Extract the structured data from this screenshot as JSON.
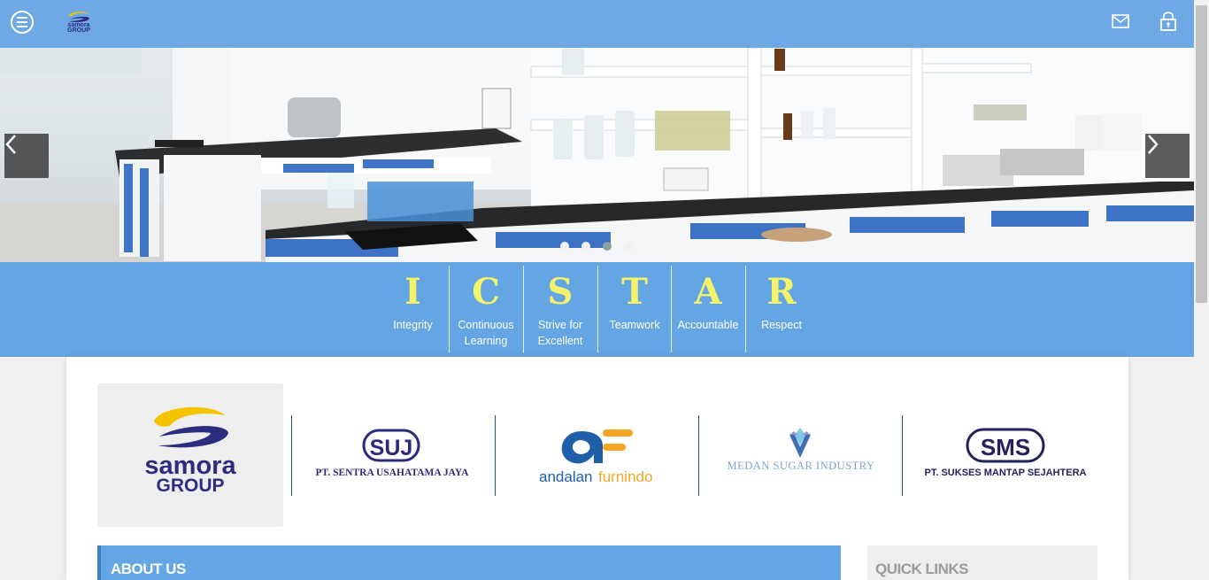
{
  "header": {
    "menu_label": "menu",
    "brand_logo_text_line1": "samora",
    "brand_logo_text_line2": "GROUP",
    "icons": [
      "menu-icon",
      "mail-icon",
      "lock-icon"
    ]
  },
  "hero": {
    "slide_count": 4,
    "active_slide": 3,
    "icons": [
      "chevron-left-icon",
      "chevron-right-icon"
    ]
  },
  "values": [
    {
      "letter": "I",
      "line1": "Integrity",
      "line2": ""
    },
    {
      "letter": "C",
      "line1": "Continuous",
      "line2": "Learning"
    },
    {
      "letter": "S",
      "line1": "Strive for",
      "line2": "Excellent"
    },
    {
      "letter": "T",
      "line1": "Teamwork",
      "line2": ""
    },
    {
      "letter": "A",
      "line1": "Accountable",
      "line2": ""
    },
    {
      "letter": "R",
      "line1": "Respect",
      "line2": ""
    }
  ],
  "group_logo": {
    "line1": "samora",
    "line2": "GROUP"
  },
  "partners": {
    "suj": {
      "badge": "SUJ",
      "name": "PT. SENTRA USAHATAMA JAYA"
    },
    "af": {
      "word1": "andalan",
      "word2": "furnindo"
    },
    "msi": {
      "name": "MEDAN SUGAR INDUSTRY"
    },
    "sms": {
      "badge": "SMS",
      "name": "PT. SUKSES MANTAP SEJAHTERA"
    }
  },
  "sections": {
    "about_title": "ABOUT US",
    "quick_links_title": "QUICK LINKS"
  },
  "colors": {
    "header_blue": "#64a5e3",
    "value_letter_yellow": "#f4f26b",
    "partner_navy": "#2b2b7e",
    "af_blue": "#1f5ea8",
    "af_orange": "#f5a623"
  }
}
